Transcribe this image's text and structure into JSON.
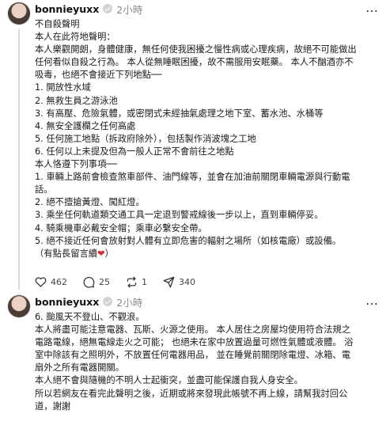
{
  "post1": {
    "username": "bonnieyuxx",
    "time": "2小時",
    "more_icon": "…",
    "lines": [
      "不自殺聲明",
      "本人在此符地聲明：",
      "本人樂觀開朗，身體健康，無任何使我困擾之慢性病或心理疾病，故絕不可能做出",
      "任何看似自殺之行為。 本人從無睡眠困擾，故不需服用安眠藥。 本人不酗酒亦不",
      "吸毒，也絕不會接近下列地點──",
      "1. 開放性水域",
      "2. 無救生員之游泳池",
      "3. 有高壓、危險氣體，或密閉式未經抽氣處理之地下室、蓄水池、水桶等",
      "4. 無安全護欄之任何高處",
      "5. 任何施工地點（拆政府除外），包括製作消波塊之工地",
      "6. 任何以上未提及但為一般人正常不會前往之地點",
      "本人恪遵下列事項──",
      "1. 車輛上路前會檢查煞車部件、油門線等，並會在加油前關閉車輛電源與行動電",
      "話。",
      "2. 絕不擅搶黃燈、闖紅燈。",
      "3. 乘坐任何軌道類交通工具一定退到警戒線後一步以上，直到車輛停妥。",
      "4. 騎乘機車必戴安全帽；乘車必繫安全帶。",
      "5. 絕不接近任何會放射對人體有立即危害的輻射之場所（如核電廠）或設備。",
      "（有點長留言續"
    ],
    "heart_emoji": "❤",
    "closing": "）",
    "likes": "462",
    "comments": "25",
    "reposts": "1",
    "shares": "340"
  },
  "post2": {
    "username": "bonnieyuxx",
    "time": "2小時",
    "more_icon": "…",
    "lines": [
      "6. 颱風天不登山、不觀浪。",
      "本人將盡可能注意電器、瓦斯、火源之使用。 本人居住之房屋均使用符合法規之",
      "電路電線，絕無電線走火之可能； 也絕未在家中放置過量可燃性氣體或液體。 浴",
      "室中除該有之照明外，不放置任何電器用品， 並在睡覺前關閉除電燈、冰箱、電",
      "扇外之所有電器開關。",
      "本人絕不會與隨機的不明人士起衝突，並盡可能保護自我人身安全。",
      "所以若網友在看完此聲明之後，近期或將來發現此帳號不再上線，請幫我討回公",
      "道，謝謝"
    ]
  }
}
